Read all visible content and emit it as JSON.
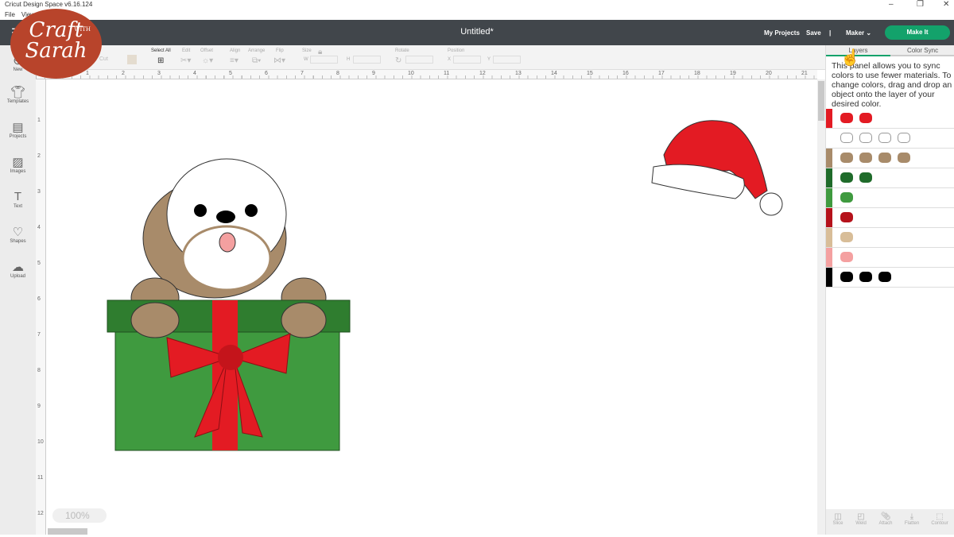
{
  "window": {
    "title": "Cricut Design Space  v6.16.124",
    "menu": [
      "File",
      "View"
    ],
    "controls": [
      "–",
      "❐",
      "✕"
    ]
  },
  "header": {
    "title": "Untitled*",
    "my_projects": "My Projects",
    "save": "Save",
    "separator": "|",
    "machine": "Maker",
    "make_it": "Make It"
  },
  "toolbar": {
    "operation_value": "Cut",
    "select_all": "Select All",
    "edit": "Edit",
    "offset": "Offset",
    "align": "Align",
    "arrange": "Arrange",
    "flip": "Flip",
    "size": "Size",
    "w": "W",
    "h": "H",
    "rotate": "Rotate",
    "position": "Position",
    "x": "X",
    "y": "Y"
  },
  "sidebar": {
    "items": [
      {
        "label": "New",
        "icon": "plus"
      },
      {
        "label": "Templates",
        "icon": "shirt"
      },
      {
        "label": "Projects",
        "icon": "notebook"
      },
      {
        "label": "Images",
        "icon": "image"
      },
      {
        "label": "Text",
        "icon": "T"
      },
      {
        "label": "Shapes",
        "icon": "shapes"
      },
      {
        "label": "Upload",
        "icon": "cloud-upload"
      }
    ]
  },
  "rulers": {
    "horizontal": [
      "1",
      "2",
      "3",
      "4",
      "5",
      "6",
      "7",
      "8",
      "9",
      "10",
      "11",
      "12",
      "13",
      "14",
      "15",
      "16",
      "17",
      "18",
      "19",
      "20",
      "21"
    ],
    "vertical": [
      "1",
      "2",
      "3",
      "4",
      "5",
      "6",
      "7",
      "8",
      "9",
      "10",
      "11",
      "12"
    ]
  },
  "canvas": {
    "zoom": "100%"
  },
  "panel": {
    "tabs": [
      "Layers",
      "Color Sync"
    ],
    "active_tab": "Color Sync",
    "description": "This panel allows you to sync colors to use fewer materials. To change colors, drag and drop an object onto the layer of your desired color.",
    "color_rows": [
      {
        "color": "#e31b23",
        "items": 2
      },
      {
        "color": "#ffffff",
        "items": 4
      },
      {
        "color": "#a88b6a",
        "items": 4
      },
      {
        "color": "#1f6b2a",
        "items": 2
      },
      {
        "color": "#3f9a3f",
        "items": 1
      },
      {
        "color": "#b5121b",
        "items": 1
      },
      {
        "color": "#d8bd98",
        "items": 1
      },
      {
        "color": "#f4a0a0",
        "items": 1
      },
      {
        "color": "#000000",
        "items": 3
      }
    ],
    "actions": [
      "Slice",
      "Weld",
      "Attach",
      "Flatten",
      "Contour"
    ]
  },
  "logo": {
    "line1": "Craft",
    "with": "WITH",
    "line2": "Sarah"
  }
}
